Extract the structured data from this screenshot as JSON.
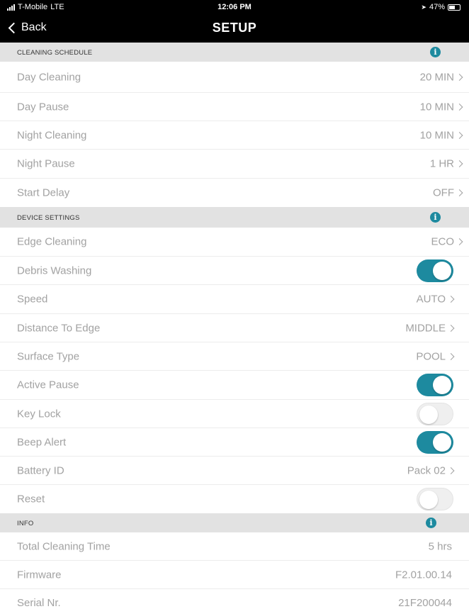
{
  "status_bar": {
    "carrier": "T-Mobile",
    "network": "LTE",
    "time": "12:06 PM",
    "battery": "47%",
    "battery_level": 0.47
  },
  "nav": {
    "back_label": "Back",
    "title": "SETUP"
  },
  "colors": {
    "accent": "#1d8a9f",
    "section_bg": "#e2e2e2",
    "bar_bg": "#000000"
  },
  "sections": {
    "cleaning_schedule": {
      "label": "CLEANING SCHEDULE",
      "info_glyph": "i"
    },
    "device_settings": {
      "label": "DEVICE SETTINGS",
      "info_glyph": "i"
    },
    "info": {
      "label": "INFO",
      "info_glyph": "i"
    }
  },
  "cleaning_schedule": {
    "day_cleaning": {
      "label": "Day Cleaning",
      "value": "20 MIN"
    },
    "day_pause": {
      "label": "Day Pause",
      "value": "10 MIN"
    },
    "night_cleaning": {
      "label": "Night Cleaning",
      "value": "10 MIN"
    },
    "night_pause": {
      "label": "Night Pause",
      "value": "1 HR"
    },
    "start_delay": {
      "label": "Start Delay",
      "value": "OFF"
    }
  },
  "device_settings": {
    "edge_cleaning": {
      "label": "Edge Cleaning",
      "value": "ECO"
    },
    "debris_washing": {
      "label": "Debris Washing",
      "on": true
    },
    "speed": {
      "label": "Speed",
      "value": "AUTO"
    },
    "distance_to_edge": {
      "label": "Distance To Edge",
      "value": "MIDDLE"
    },
    "surface_type": {
      "label": "Surface Type",
      "value": "POOL"
    },
    "active_pause": {
      "label": "Active Pause",
      "on": true
    },
    "key_lock": {
      "label": "Key Lock",
      "on": false
    },
    "beep_alert": {
      "label": "Beep Alert",
      "on": true
    },
    "battery_id": {
      "label": "Battery ID",
      "value": "Pack 02"
    },
    "reset": {
      "label": "Reset",
      "on": false
    }
  },
  "info": {
    "total_cleaning_time": {
      "label": "Total Cleaning Time",
      "value": "5 hrs"
    },
    "firmware": {
      "label": "Firmware",
      "value": "F2.01.00.14"
    },
    "serial": {
      "label": "Serial Nr.",
      "value": "21F200044"
    }
  }
}
